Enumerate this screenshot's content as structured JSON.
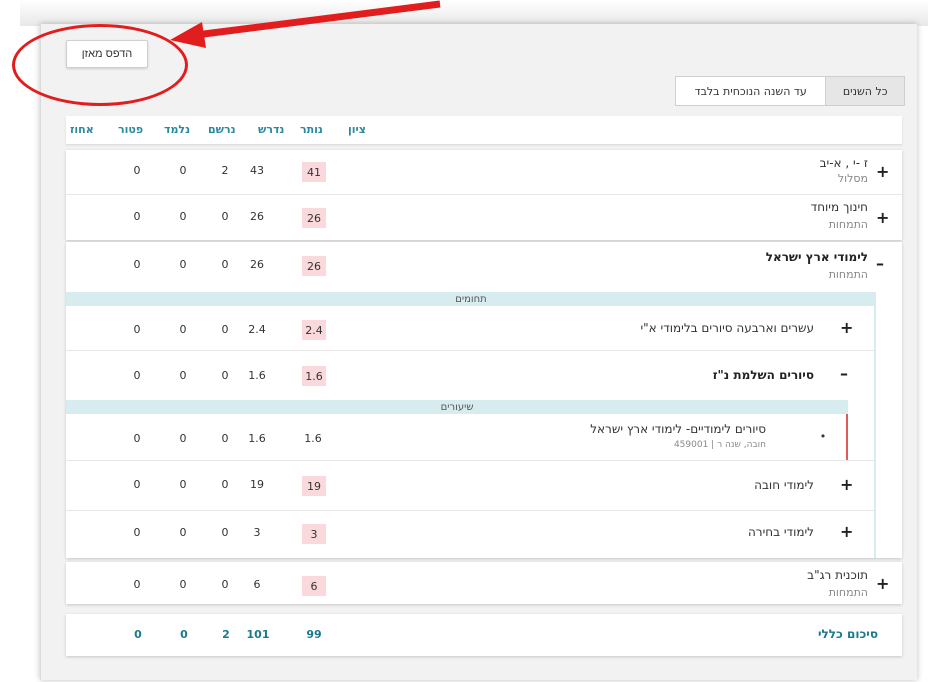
{
  "print_button_label": "הדפס מאזן",
  "toggle": {
    "current_year_label": "עד השנה הנוכחית בלבד",
    "all_years_label": "כל השנים"
  },
  "columns": [
    "ציון",
    "נותר",
    "נדרש",
    "נרשם",
    "נלמד",
    "פטור",
    "אחוז"
  ],
  "rows": [
    {
      "title": "ז -י , א-יב",
      "subtitle": "מסלול",
      "remaining": "41",
      "required": "43",
      "registered": "2",
      "learned": "0",
      "exempt": "0"
    },
    {
      "title": "חינוך מיוחד",
      "subtitle": "התמחות",
      "remaining": "26",
      "required": "26",
      "registered": "0",
      "learned": "0",
      "exempt": "0"
    },
    {
      "title": "לימודי ארץ ישראל",
      "subtitle": "התמחות",
      "remaining": "26",
      "required": "26",
      "registered": "0",
      "learned": "0",
      "exempt": "0"
    }
  ],
  "domains_label": "תחומים",
  "sub_rows": [
    {
      "title": "עשרים וארבעה סיורים בלימודי א\"י",
      "remaining": "2.4",
      "required": "2.4",
      "registered": "0",
      "learned": "0",
      "exempt": "0"
    },
    {
      "title": "סיורים השלמת נ\"ז",
      "remaining": "1.6",
      "required": "1.6",
      "registered": "0",
      "learned": "0",
      "exempt": "0"
    }
  ],
  "lessons_label": "שיעורים",
  "lesson": {
    "title": "סיורים לימודיים- לימודי ארץ ישראל",
    "meta": "459001 | חובה, שנה ר",
    "remaining": "1.6",
    "required": "1.6",
    "registered": "0",
    "learned": "0",
    "exempt": "0"
  },
  "sub_rows_2": [
    {
      "title": "לימודי חובה",
      "remaining": "19",
      "required": "19",
      "registered": "0",
      "learned": "0",
      "exempt": "0"
    },
    {
      "title": "לימודי בחירה",
      "remaining": "3",
      "required": "3",
      "registered": "0",
      "learned": "0",
      "exempt": "0"
    }
  ],
  "row_last": {
    "title": "תוכנית רג\"ב",
    "subtitle": "התמחות",
    "remaining": "6",
    "required": "6",
    "registered": "0",
    "learned": "0",
    "exempt": "0"
  },
  "summary": {
    "label": "סיכום כללי",
    "remaining": "99",
    "required": "101",
    "registered": "2",
    "learned": "0",
    "exempt": "0"
  },
  "icons": {
    "expand": "+",
    "collapse": "–",
    "bullet": "•"
  },
  "colors": {
    "accent": "#2a8aa0",
    "highlight": "#f9d9dc",
    "annotation": "#e11d1d",
    "strip": "#d6ecef"
  }
}
